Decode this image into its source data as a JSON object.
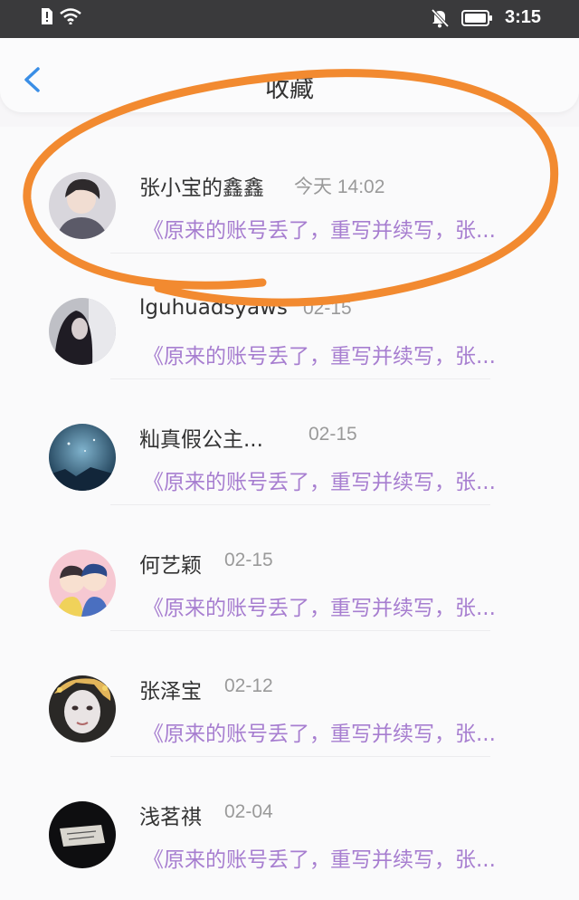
{
  "status_bar": {
    "time": "3:15"
  },
  "header": {
    "title": "收藏",
    "back_icon": "chevron-left-icon"
  },
  "items": [
    {
      "name": "张小宝的鑫鑫",
      "time": "今天 14:02",
      "preview": "《原来的账号丢了，重写并续写，张..."
    },
    {
      "name": "lguhuadsyaws",
      "time": "02-15",
      "preview": "《原来的账号丢了，重写并续写，张..."
    },
    {
      "name": "籼真假公主...",
      "time": "02-15",
      "preview": "《原来的账号丢了，重写并续写，张..."
    },
    {
      "name": "何艺颖",
      "time": "02-15",
      "preview": "《原来的账号丢了，重写并续写，张..."
    },
    {
      "name": "张泽宝",
      "time": "02-12",
      "preview": "《原来的账号丢了，重写并续写，张..."
    },
    {
      "name": "浅茗祺",
      "time": "02-04",
      "preview": "《原来的账号丢了，重写并续写，张..."
    }
  ],
  "colors": {
    "accent_blue": "#3a8ee6",
    "preview_purple": "#a77ed0",
    "annotation_orange": "#f28a30"
  }
}
